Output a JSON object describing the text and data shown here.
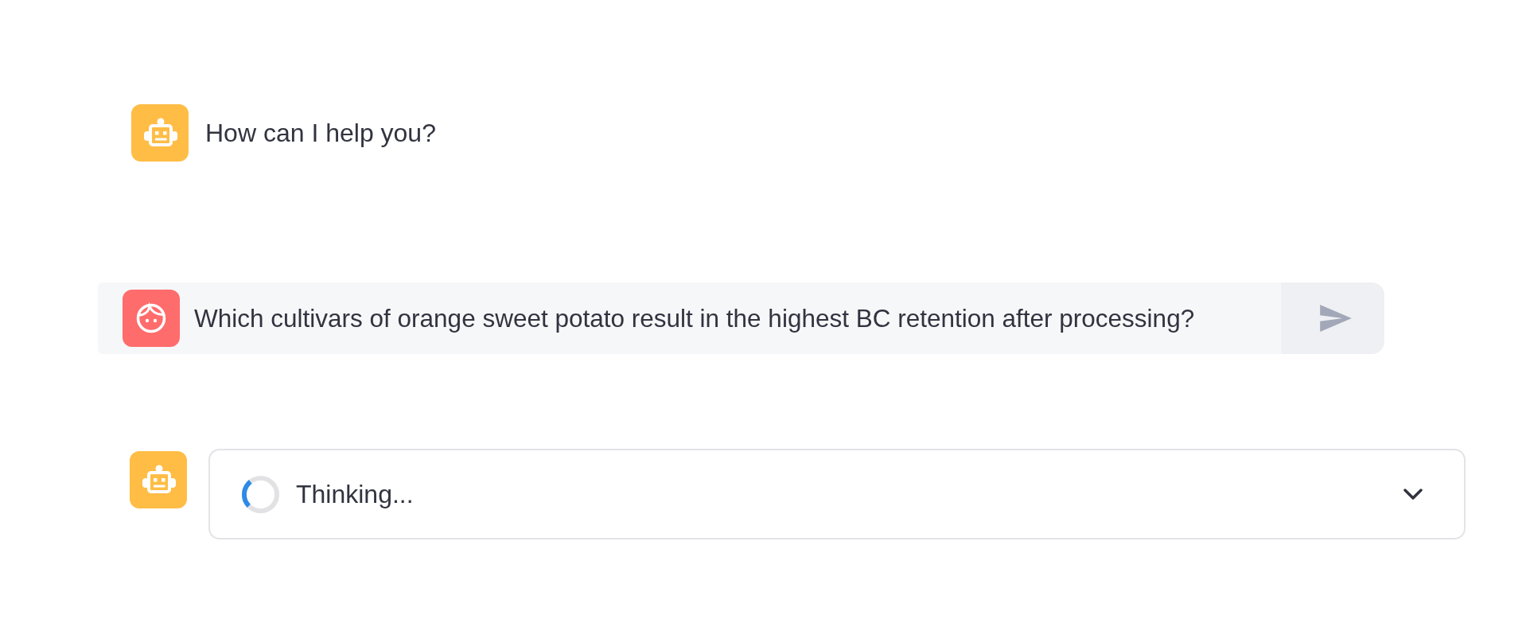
{
  "messages": [
    {
      "kind": "assistant",
      "text": "How can I help you?"
    },
    {
      "kind": "user",
      "text": "Which cultivars of orange sweet potato result in the highest BC retention after processing?"
    },
    {
      "kind": "status",
      "label": "Thinking...",
      "expanded": false
    }
  ]
}
